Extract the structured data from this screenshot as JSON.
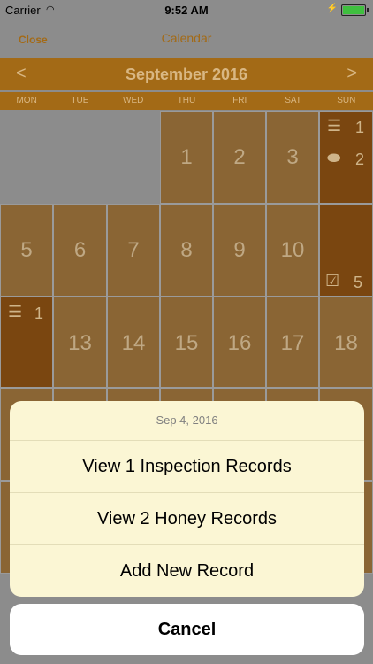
{
  "status_bar": {
    "carrier": "Carrier",
    "time": "9:52 AM"
  },
  "navbar": {
    "close_label": "Close",
    "title": "Calendar"
  },
  "calendar": {
    "month_title": "September 2016",
    "prev_label": "<",
    "next_label": ">",
    "weekdays": [
      "MON",
      "TUE",
      "WED",
      "THU",
      "FRI",
      "SAT",
      "SUN"
    ],
    "days": {
      "d1": "1",
      "d2": "2",
      "d3": "3",
      "d5": "5",
      "d6": "6",
      "d7": "7",
      "d8": "8",
      "d9": "9",
      "d10": "10",
      "d13": "13",
      "d14": "14",
      "d15": "15",
      "d16": "16",
      "d17": "17",
      "d18": "18"
    },
    "records": {
      "sun4_inspection_count": "1",
      "sun4_honey_count": "2",
      "sun11_tasks_count": "5",
      "mon12_inspection_count": "1"
    }
  },
  "action_sheet": {
    "header": "Sep 4, 2016",
    "actions": [
      "View 1 Inspection Records",
      "View 2 Honey Records",
      "Add New Record"
    ],
    "cancel_label": "Cancel"
  },
  "colors": {
    "accent": "#a36a16",
    "day_cell": "#8a6534",
    "record_cell": "#7a4610",
    "sheet_bg": "#fbf6d4"
  }
}
